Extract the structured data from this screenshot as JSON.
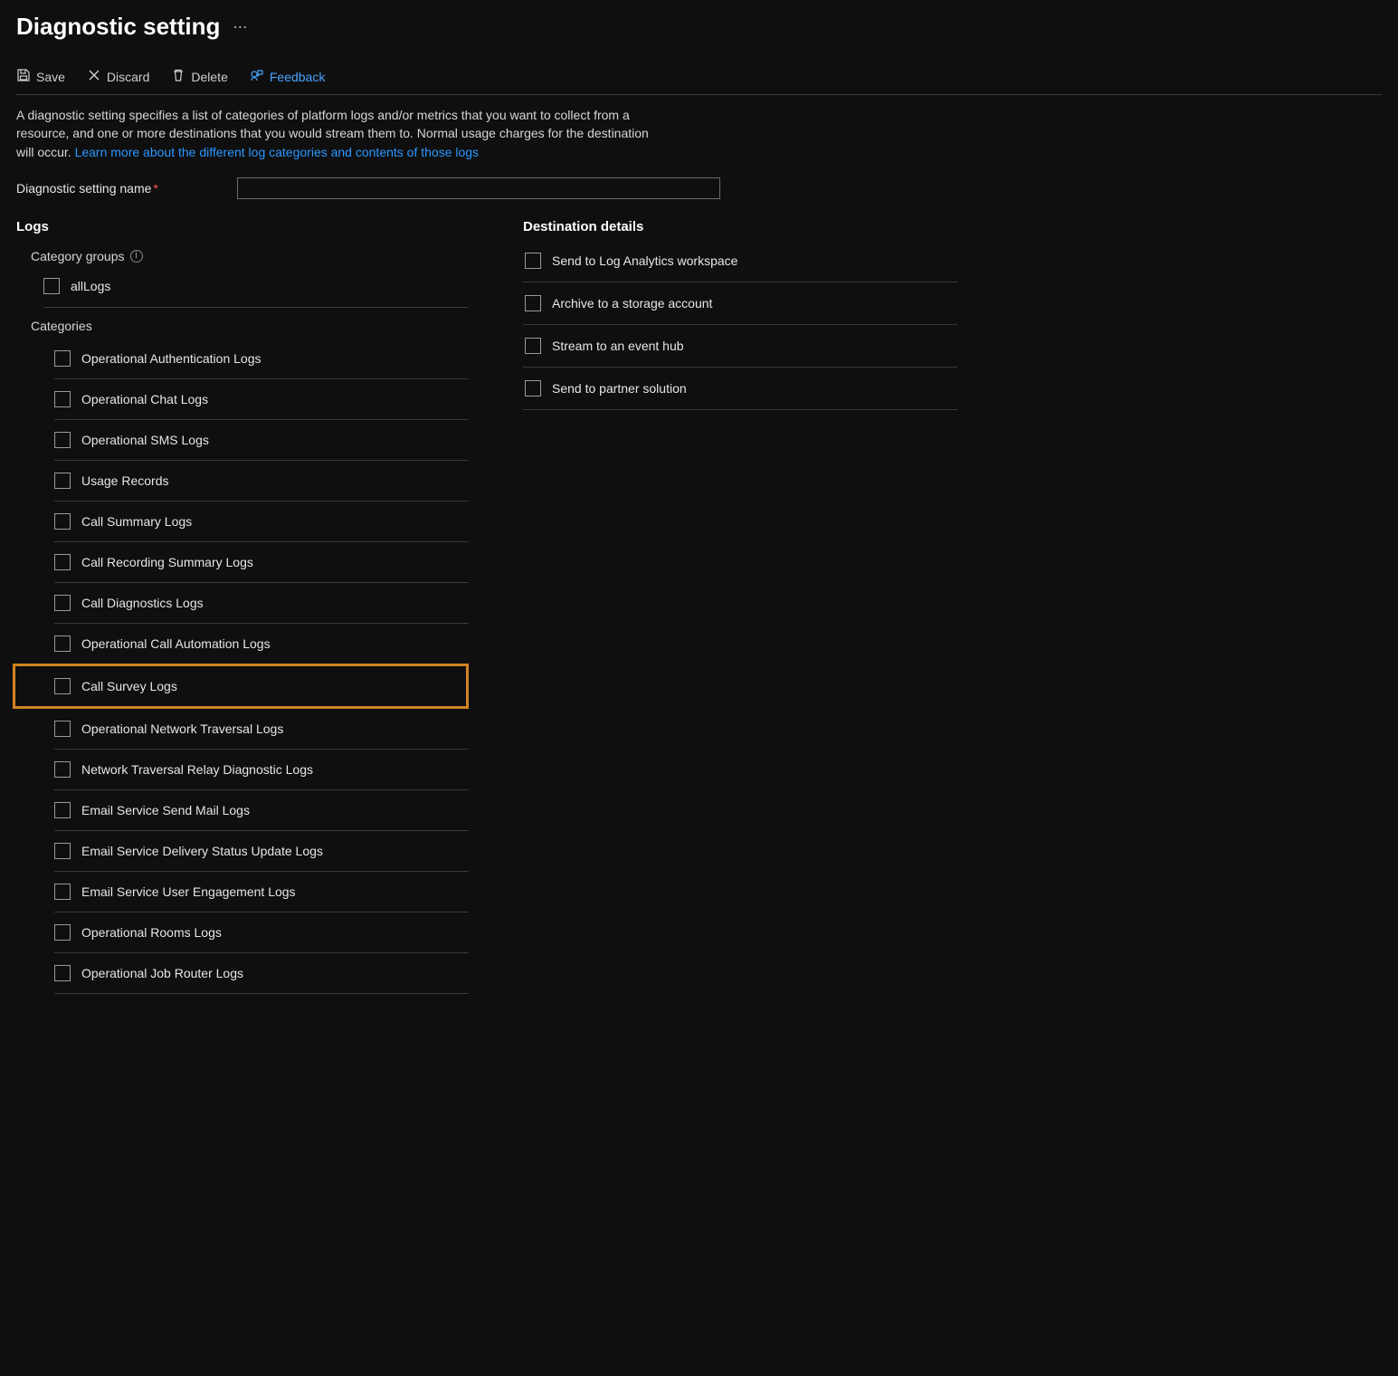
{
  "header": {
    "title": "Diagnostic setting"
  },
  "toolbar": {
    "save": "Save",
    "discard": "Discard",
    "delete": "Delete",
    "feedback": "Feedback"
  },
  "description": {
    "text": "A diagnostic setting specifies a list of categories of platform logs and/or metrics that you want to collect from a resource, and one or more destinations that you would stream them to. Normal usage charges for the destination will occur. ",
    "link": "Learn more about the different log categories and contents of those logs"
  },
  "form": {
    "name_label": "Diagnostic setting name",
    "name_value": ""
  },
  "logs": {
    "title": "Logs",
    "category_groups_label": "Category groups",
    "all_logs": "allLogs",
    "categories_label": "Categories",
    "categories": [
      "Operational Authentication Logs",
      "Operational Chat Logs",
      "Operational SMS Logs",
      "Usage Records",
      "Call Summary Logs",
      "Call Recording Summary Logs",
      "Call Diagnostics Logs",
      "Operational Call Automation Logs",
      "Call Survey Logs",
      "Operational Network Traversal Logs",
      "Network Traversal Relay Diagnostic Logs",
      "Email Service Send Mail Logs",
      "Email Service Delivery Status Update Logs",
      "Email Service User Engagement Logs",
      "Operational Rooms Logs",
      "Operational Job Router Logs"
    ],
    "highlighted_index": 8
  },
  "destinations": {
    "title": "Destination details",
    "items": [
      "Send to Log Analytics workspace",
      "Archive to a storage account",
      "Stream to an event hub",
      "Send to partner solution"
    ]
  }
}
